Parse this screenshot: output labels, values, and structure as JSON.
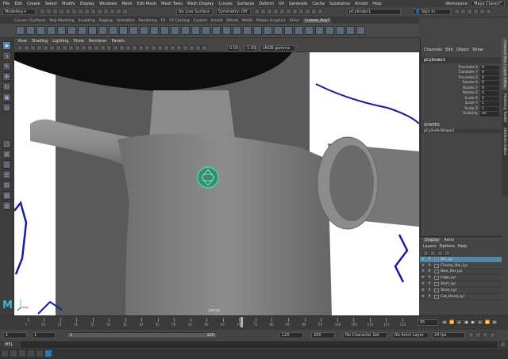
{
  "menubar": {
    "items": [
      "File",
      "Edit",
      "Create",
      "Select",
      "Modify",
      "Display",
      "Windows",
      "Mesh",
      "Edit Mesh",
      "Mesh Tools",
      "Mesh Display",
      "Curves",
      "Surfaces",
      "Deform",
      "UV",
      "Generate",
      "Cache",
      "Substance",
      "Arnold",
      "Help"
    ],
    "workspace_label": "Workspace:",
    "workspace_value": "Maya Classic*"
  },
  "status": {
    "mode": "Modeling",
    "live_surface": "No Live Surface",
    "symmetry": "Symmetry: Off",
    "object_field": "pCylinder1",
    "sign_in": "Sign In"
  },
  "shelf": {
    "tabs": [
      "Curves / Surfaces",
      "Poly Modeling",
      "Sculpting",
      "Rigging",
      "Animation",
      "Rendering",
      "FX",
      "FX Caching",
      "Custom",
      "Arnold",
      "Bifrost",
      "MASH",
      "Motion Graphics",
      "XGen",
      "Custom_PolyT"
    ],
    "active_tab": "Custom_PolyT"
  },
  "panel": {
    "menus": [
      "View",
      "Shading",
      "Lighting",
      "Show",
      "Renderer",
      "Panels"
    ],
    "exposure": "0.00",
    "gamma": "1.00",
    "colorspace": "sRGB gamma",
    "camera_label": "persp"
  },
  "channel_box": {
    "menus": [
      "Channels",
      "Edit",
      "Object",
      "Show"
    ],
    "object_name": "pCylinder1",
    "attributes": [
      {
        "label": "Translate X",
        "value": "0"
      },
      {
        "label": "Translate Y",
        "value": "0"
      },
      {
        "label": "Translate Z",
        "value": "0"
      },
      {
        "label": "Rotate X",
        "value": "0"
      },
      {
        "label": "Rotate Y",
        "value": "0"
      },
      {
        "label": "Rotate Z",
        "value": "0"
      },
      {
        "label": "Scale X",
        "value": "1"
      },
      {
        "label": "Scale Y",
        "value": "1"
      },
      {
        "label": "Scale Z",
        "value": "1"
      },
      {
        "label": "Visibility",
        "value": "on"
      }
    ],
    "shapes_header": "SHAPES",
    "shape_name": "pCylinderShape1"
  },
  "side_tabs": [
    "Channel Box / Layer Editor",
    "Modeling Toolkit",
    "Attribute Editor"
  ],
  "layer_editor": {
    "tabs": [
      "Display",
      "Anim"
    ],
    "menus": [
      "Layers",
      "Options",
      "Help"
    ],
    "layers": [
      {
        "v": "V",
        "p": "P",
        "name": "Bel_Lyr",
        "selected": true
      },
      {
        "v": "V",
        "p": "P",
        "name": "Champ_Bel_Lyr",
        "selected": false
      },
      {
        "v": "V",
        "p": "R",
        "name": "Bwa_Bel_Lyr",
        "selected": false
      },
      {
        "v": "V",
        "p": "P",
        "name": "Logo_Lyr",
        "selected": false
      },
      {
        "v": "V",
        "p": "P",
        "name": "Skirt_Lyr",
        "selected": false
      },
      {
        "v": "V",
        "p": "P",
        "name": "Torso_Lyr",
        "selected": false
      },
      {
        "v": "V",
        "p": "P",
        "name": "Cat_Head_Lyr",
        "selected": false
      }
    ]
  },
  "timeline": {
    "ticks": [
      "5",
      "10",
      "15",
      "20",
      "25",
      "30",
      "35",
      "40",
      "45",
      "50",
      "55",
      "60",
      "65",
      "70",
      "75",
      "80",
      "85",
      "90",
      "95",
      "100",
      "105",
      "110",
      "115",
      "120"
    ],
    "current_frame": "95",
    "current_time_field": "95"
  },
  "range": {
    "start": "1",
    "start_inner": "1",
    "slider_start": "1",
    "slider_end": "120",
    "end_inner": "120",
    "end": "200",
    "character_set": "No Character Set",
    "anim_layer": "No Anim Layer",
    "fps": "24 fps"
  },
  "cmdline": {
    "lang": "MEL"
  },
  "colors": {
    "accent": "#5285a6",
    "selection_green": "#44d8a0",
    "curve_blue": "#1a1aa0"
  },
  "icons": {
    "toolbox": [
      "select-arrow-icon",
      "lasso-icon",
      "paint-select-icon",
      "move-icon",
      "rotate-icon",
      "scale-icon",
      "last-tool-icon"
    ],
    "layouts": [
      "single-view-icon",
      "four-view-icon",
      "two-view-icon",
      "outliner-layout-icon"
    ]
  }
}
